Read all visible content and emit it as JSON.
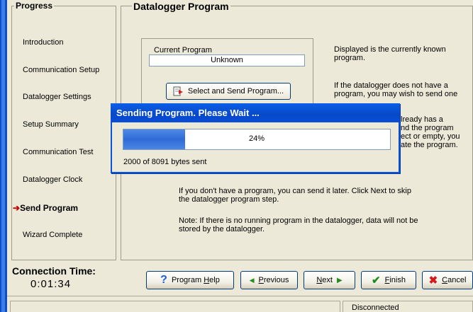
{
  "progress": {
    "title": "Progress",
    "steps": [
      {
        "label": "Introduction"
      },
      {
        "label": "Communication Setup"
      },
      {
        "label": "Datalogger Settings"
      },
      {
        "label": "Setup Summary"
      },
      {
        "label": "Communication Test"
      },
      {
        "label": "Datalogger Clock"
      },
      {
        "label": "Send Program",
        "active": true
      },
      {
        "label": "Wizard Complete"
      }
    ]
  },
  "program": {
    "title": "Datalogger Program",
    "current_label": "Current Program",
    "current_value": "Unknown",
    "send_button": "Select and Send Program...",
    "info_1": "Displayed is the currently known program.",
    "info_2": "If the datalogger does not have a program, you may wish to send one",
    "partial_1": "lready has a",
    "partial_2": "nd the program",
    "partial_3": "ect or empty, you",
    "partial_4": "ate the program.",
    "later_text": "If you don't have a program, you can send it later.  Click Next to skip the datalogger program step.",
    "note_text": "Note: If there is no running program in the datalogger, data will not be stored by the datalogger."
  },
  "dialog": {
    "title": "Sending Program.  Please Wait ...",
    "progress_percent": 24,
    "progress_text": "24%",
    "bytes_text": "2000 of 8091 bytes sent"
  },
  "connection": {
    "label": "Connection Time:",
    "value": "0:01:34"
  },
  "buttons": {
    "help": "Program Help",
    "help_key": "H",
    "previous": "Previous",
    "previous_key": "P",
    "next": "Next",
    "next_key": "N",
    "finish": "Finish",
    "finish_key": "F",
    "cancel": "Cancel",
    "cancel_key": "C"
  },
  "status": {
    "connection_state": "Disconnected"
  },
  "colors": {
    "accent": "#0a4ec9",
    "progress_fill": "#2f6bd6",
    "active_arrow": "#c00000"
  }
}
